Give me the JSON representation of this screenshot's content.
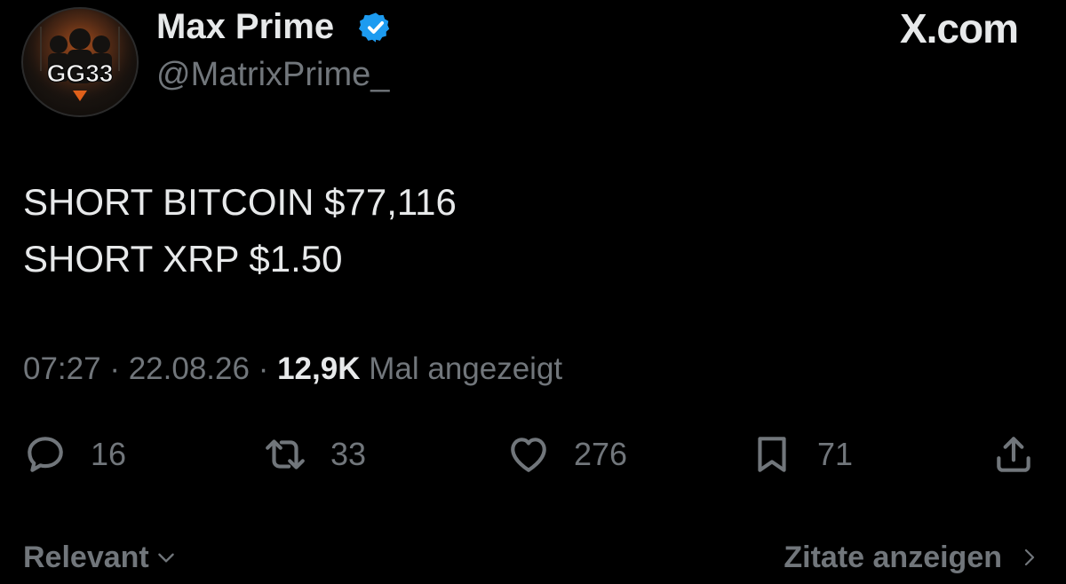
{
  "header": {
    "display_name": "Max Prime",
    "handle": "@MatrixPrime_",
    "verified_icon": "verified-badge-icon",
    "avatar_text": "GG33",
    "watermark": "X.com"
  },
  "tweet": {
    "lines": [
      "SHORT BITCOIN $77,116",
      "SHORT XRP $1.50"
    ]
  },
  "meta": {
    "time": "07:27",
    "separator": "·",
    "date": "22.08.26",
    "views_count": "12,9K",
    "views_label": "Mal angezeigt"
  },
  "actions": {
    "reply": {
      "icon": "reply-icon",
      "count": "16"
    },
    "retweet": {
      "icon": "retweet-icon",
      "count": "33"
    },
    "like": {
      "icon": "heart-icon",
      "count": "276"
    },
    "bookmark": {
      "icon": "bookmark-icon",
      "count": "71"
    },
    "share": {
      "icon": "share-icon"
    }
  },
  "footer": {
    "sort_label": "Relevant",
    "quotes_label": "Zitate anzeigen"
  },
  "colors": {
    "background": "#000000",
    "text_primary": "#e7e9ea",
    "text_secondary": "#71767b",
    "verified_blue": "#1d9bf0"
  }
}
